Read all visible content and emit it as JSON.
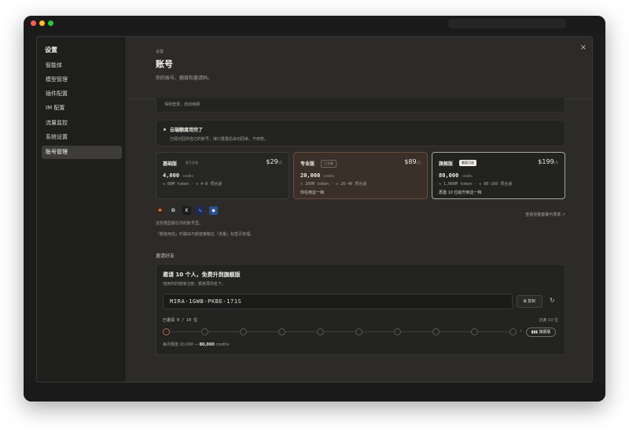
{
  "sidebar": {
    "title": "设置",
    "items": [
      {
        "label": "智能体"
      },
      {
        "label": "模型管理"
      },
      {
        "label": "插件配置"
      },
      {
        "label": "IM 配置"
      },
      {
        "label": "流量监控"
      },
      {
        "label": "系统设置"
      },
      {
        "label": "账号管理",
        "active": true
      }
    ]
  },
  "header": {
    "breadcrumb": "设置",
    "title": "账号",
    "subtitle": "你的账号、额度和邀请码。",
    "close": "×"
  },
  "keep_login": "保持登录，自动续期",
  "alert": {
    "title": "云端额度用完了",
    "desc": "已经切回你自己的账号，接口重置后会切回来，不用管。"
  },
  "plans": [
    {
      "name": "基础版",
      "tag": "低于主站",
      "price": "$29",
      "per": "/月",
      "credits": "4,000",
      "credits_unit": "credits",
      "detail": "≈ 80M token · ≈ 4-8 项合适",
      "note": ""
    },
    {
      "name": "专业版",
      "tag": "已主推",
      "price": "$89",
      "per": "/月",
      "credits": "20,000",
      "credits_unit": "credits",
      "detail": "≈ 200M token · ≈ 20-40 项合适",
      "note": "你在用这一档"
    },
    {
      "name": "旗舰版",
      "tag": "最值可选",
      "price": "$199",
      "per": "/月",
      "credits": "80,000",
      "credits_unit": "credits",
      "detail": "≈ 1,000M token · ≈ 80-160 项合适",
      "note": "再邀 10 位就升到这一档"
    }
  ],
  "models": {
    "icons": [
      "anthropic-icon",
      "openai-icon",
      "kimi-icon",
      "zhipu-icon",
      "gemini-icon"
    ],
    "view_all": "查看完整套餐与费率 ↗",
    "note1": "这些模型都在你的账号里。",
    "note2": "「额度用完」时路由与额度策略在「流量」标签页管理。"
  },
  "invite": {
    "section_label": "邀请好友",
    "title": "邀请 10 个人，免费升到旗舰版",
    "sub": "他用你的链接注册，额度再你名下。",
    "code": "MIRA-1GWB-PKBE-171S",
    "copy_label": "复制",
    "invited_text": "已邀请 0 / 10 位",
    "remain_text": "还差 10 位",
    "flag_label": "旗舰版",
    "monthly_prefix": "每月额度 20,000 → ",
    "monthly_target": "80,000",
    "monthly_suffix": " credits",
    "progress_invited": 0,
    "progress_total": 10
  },
  "colors": {
    "accent_pro_border": "#6a4a3c",
    "first_node": "#b7644f"
  }
}
